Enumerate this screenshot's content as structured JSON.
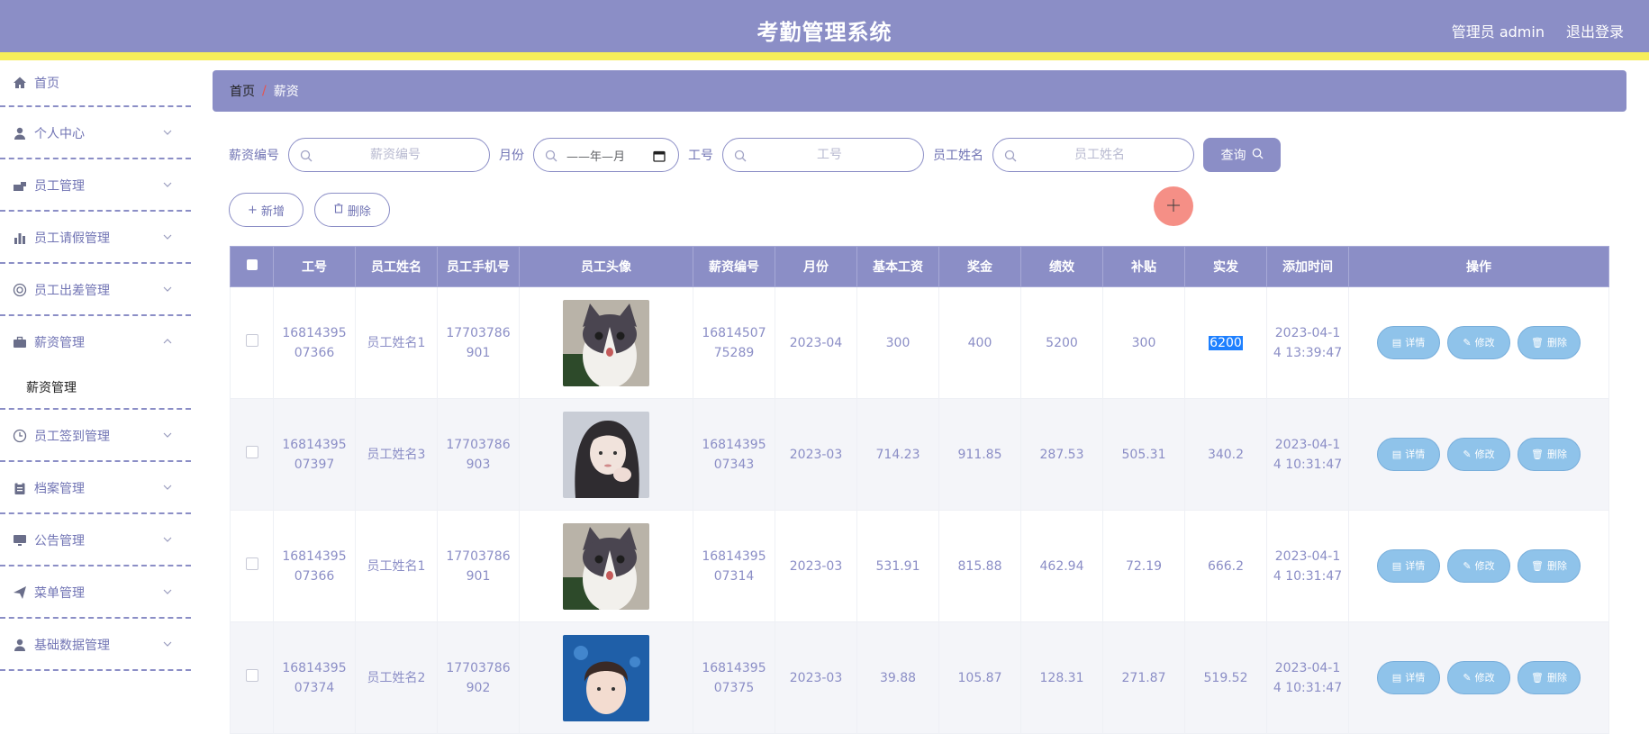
{
  "header": {
    "title": "考勤管理系统",
    "user_label": "管理员 admin",
    "logout_label": "退出登录"
  },
  "sidebar": {
    "items": [
      {
        "label": "首页",
        "icon": "home-icon"
      },
      {
        "label": "个人中心",
        "icon": "user-icon"
      },
      {
        "label": "员工管理",
        "icon": "employee-icon"
      },
      {
        "label": "员工请假管理",
        "icon": "chart-icon"
      },
      {
        "label": "员工出差管理",
        "icon": "lifebuoy-icon"
      },
      {
        "label": "薪资管理",
        "icon": "briefcase-icon",
        "expanded": true,
        "sub_item": "薪资管理"
      },
      {
        "label": "员工签到管理",
        "icon": "clock-icon"
      },
      {
        "label": "档案管理",
        "icon": "clipboard-icon"
      },
      {
        "label": "公告管理",
        "icon": "monitor-icon"
      },
      {
        "label": "菜单管理",
        "icon": "send-icon"
      },
      {
        "label": "基础数据管理",
        "icon": "user-icon"
      }
    ]
  },
  "breadcrumb": {
    "home": "首页",
    "separator": "/",
    "current": "薪资"
  },
  "search": {
    "salary_no_label": "薪资编号",
    "salary_no_placeholder": "薪资编号",
    "month_label": "月份",
    "month_value": "——年—月",
    "emp_no_label": "工号",
    "emp_no_placeholder": "工号",
    "emp_name_label": "员工姓名",
    "emp_name_placeholder": "员工姓名",
    "query_label": "查询"
  },
  "actions": {
    "add_label": "新增",
    "delete_label": "删除"
  },
  "table": {
    "columns": [
      "工号",
      "员工姓名",
      "员工手机号",
      "员工头像",
      "薪资编号",
      "月份",
      "基本工资",
      "奖金",
      "绩效",
      "补贴",
      "实发",
      "添加时间",
      "操作"
    ],
    "rows": [
      {
        "emp_no": [
          "16814395",
          "07366"
        ],
        "name": "员工姓名1",
        "phone": [
          "17703786",
          "901"
        ],
        "avatar": "cat",
        "salary_no": [
          "16814507",
          "75289"
        ],
        "month": "2023-04",
        "base": "300",
        "bonus": "400",
        "perf": "5200",
        "allowance": "300",
        "net": "6200",
        "time": [
          "2023-04-1",
          "4 13:39:47"
        ]
      },
      {
        "emp_no": [
          "16814395",
          "07397"
        ],
        "name": "员工姓名3",
        "phone": [
          "17703786",
          "903"
        ],
        "avatar": "girl",
        "salary_no": [
          "16814395",
          "07343"
        ],
        "month": "2023-03",
        "base": "714.23",
        "bonus": "911.85",
        "perf": "287.53",
        "allowance": "505.31",
        "net": "340.2",
        "time": [
          "2023-04-1",
          "4 10:31:47"
        ]
      },
      {
        "emp_no": [
          "16814395",
          "07366"
        ],
        "name": "员工姓名1",
        "phone": [
          "17703786",
          "901"
        ],
        "avatar": "cat",
        "salary_no": [
          "16814395",
          "07314"
        ],
        "month": "2023-03",
        "base": "531.91",
        "bonus": "815.88",
        "perf": "462.94",
        "allowance": "72.19",
        "net": "666.2",
        "time": [
          "2023-04-1",
          "4 10:31:47"
        ]
      },
      {
        "emp_no": [
          "16814395",
          "07374"
        ],
        "name": "员工姓名2",
        "phone": [
          "17703786",
          "902"
        ],
        "avatar": "boy",
        "salary_no": [
          "16814395",
          "07375"
        ],
        "month": "2023-03",
        "base": "39.88",
        "bonus": "105.87",
        "perf": "128.31",
        "allowance": "271.87",
        "net": "519.52",
        "time": [
          "2023-04-1",
          "4 10:31:47"
        ]
      }
    ],
    "op_labels": {
      "detail": "详情",
      "edit": "修改",
      "delete": "删除"
    }
  },
  "colors": {
    "primary": "#8b8ec6",
    "accent_strip": "#f6ee5a",
    "op_button": "#8fc3ea",
    "cursor": "#f58a80"
  }
}
